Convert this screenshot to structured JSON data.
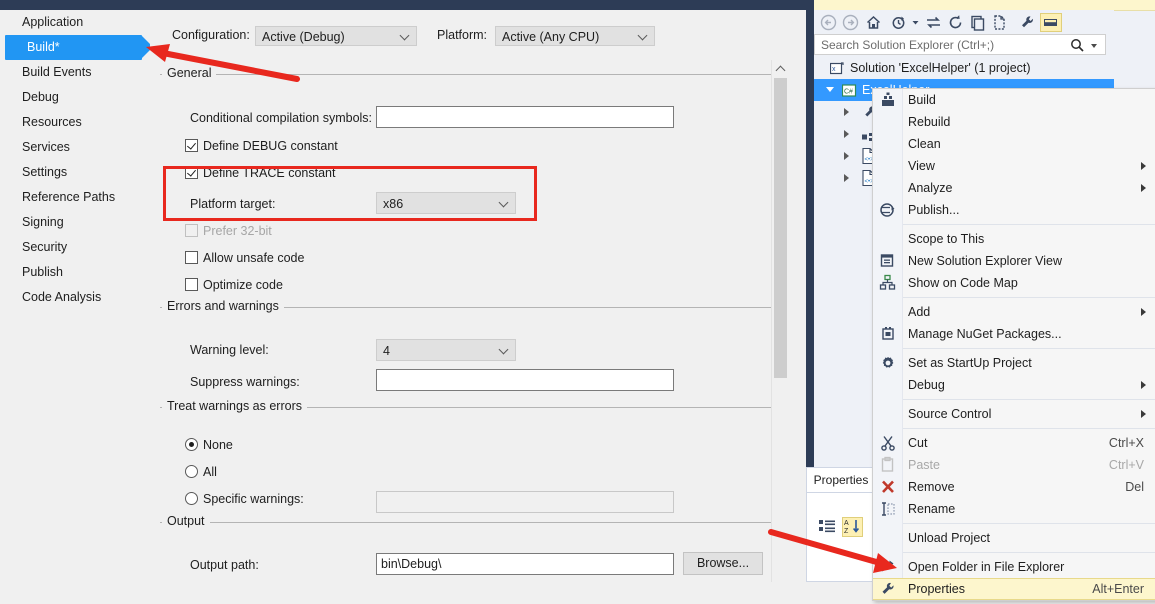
{
  "properties_page": {
    "tabs": [
      {
        "label": "Application",
        "selected": false
      },
      {
        "label": "Build*",
        "selected": true
      },
      {
        "label": "Build Events",
        "selected": false
      },
      {
        "label": "Debug",
        "selected": false
      },
      {
        "label": "Resources",
        "selected": false
      },
      {
        "label": "Services",
        "selected": false
      },
      {
        "label": "Settings",
        "selected": false
      },
      {
        "label": "Reference Paths",
        "selected": false
      },
      {
        "label": "Signing",
        "selected": false
      },
      {
        "label": "Security",
        "selected": false
      },
      {
        "label": "Publish",
        "selected": false
      },
      {
        "label": "Code Analysis",
        "selected": false
      }
    ],
    "configuration": {
      "label": "Configuration:",
      "value": "Active (Debug)"
    },
    "platform": {
      "label": "Platform:",
      "value": "Active (Any CPU)"
    },
    "general": {
      "title": "General",
      "conditional_symbols_label": "Conditional compilation symbols:",
      "conditional_symbols_value": "",
      "define_debug_label": "Define DEBUG constant",
      "define_debug_checked": true,
      "define_trace_label": "Define TRACE constant",
      "define_trace_checked": true,
      "platform_target_label": "Platform target:",
      "platform_target_value": "x86",
      "prefer32_label": "Prefer 32-bit",
      "prefer32_checked": false,
      "allow_unsafe_label": "Allow unsafe code",
      "allow_unsafe_checked": false,
      "optimize_label": "Optimize code",
      "optimize_checked": false
    },
    "errors_warnings": {
      "title": "Errors and warnings",
      "warning_level_label": "Warning level:",
      "warning_level_value": "4",
      "suppress_label": "Suppress warnings:",
      "suppress_value": ""
    },
    "treat_warnings": {
      "title": "Treat warnings as errors",
      "none_label": "None",
      "all_label": "All",
      "specific_label": "Specific warnings:",
      "specific_value": "",
      "selected": "None"
    },
    "output": {
      "title": "Output",
      "output_path_label": "Output path:",
      "output_path_value": "bin\\Debug\\",
      "browse_label": "Browse..."
    }
  },
  "solution_explorer": {
    "toolbar_icons": [
      "back-icon",
      "forward-icon",
      "home-icon",
      "pending-changes-icon",
      "sync-with-active-document-icon",
      "refresh-icon",
      "collapse-all-icon",
      "show-all-files-icon",
      "properties-icon",
      "preview-selected-items-icon"
    ],
    "search": {
      "placeholder": "Search Solution Explorer (Ctrl+;)",
      "value": ""
    },
    "tree": [
      {
        "label": "Solution 'ExcelHelper' (1 project)",
        "icon": "solution-icon",
        "depth": 0,
        "selected": false,
        "expander": "none"
      },
      {
        "label": "ExcelHelper",
        "icon": "csharp-project-icon",
        "depth": 1,
        "selected": true,
        "expander": "open"
      },
      {
        "label": "",
        "icon": "properties-wrench-icon",
        "depth": 2,
        "selected": false,
        "expander": "closed"
      },
      {
        "label": "",
        "icon": "references-icon",
        "depth": 2,
        "selected": false,
        "expander": "closed"
      },
      {
        "label": "",
        "icon": "code-file-icon",
        "depth": 2,
        "selected": false,
        "expander": "closed"
      },
      {
        "label": "",
        "icon": "code-file-icon",
        "depth": 2,
        "selected": false,
        "expander": "closed"
      }
    ],
    "properties_dock": {
      "tab_label": "Properties",
      "categorized_icon": "categorized-icon",
      "alphabetical_icon": "alphabetical-sort-icon"
    }
  },
  "context_menu": {
    "items": [
      {
        "label": "Build",
        "icon": "build-icon",
        "shortcut": "",
        "submenu": false,
        "disabled": false,
        "highlighted": false,
        "sep_after": false
      },
      {
        "label": "Rebuild",
        "icon": "",
        "shortcut": "",
        "submenu": false,
        "disabled": false,
        "highlighted": false,
        "sep_after": false
      },
      {
        "label": "Clean",
        "icon": "",
        "shortcut": "",
        "submenu": false,
        "disabled": false,
        "highlighted": false,
        "sep_after": false
      },
      {
        "label": "View",
        "icon": "",
        "shortcut": "",
        "submenu": true,
        "disabled": false,
        "highlighted": false,
        "sep_after": false
      },
      {
        "label": "Analyze",
        "icon": "",
        "shortcut": "",
        "submenu": true,
        "disabled": false,
        "highlighted": false,
        "sep_after": false
      },
      {
        "label": "Publish...",
        "icon": "publish-icon",
        "shortcut": "",
        "submenu": false,
        "disabled": false,
        "highlighted": false,
        "sep_after": true
      },
      {
        "label": "Scope to This",
        "icon": "",
        "shortcut": "",
        "submenu": false,
        "disabled": false,
        "highlighted": false,
        "sep_after": false
      },
      {
        "label": "New Solution Explorer View",
        "icon": "new-window-icon",
        "shortcut": "",
        "submenu": false,
        "disabled": false,
        "highlighted": false,
        "sep_after": false
      },
      {
        "label": "Show on Code Map",
        "icon": "code-map-icon",
        "shortcut": "",
        "submenu": false,
        "disabled": false,
        "highlighted": false,
        "sep_after": true
      },
      {
        "label": "Add",
        "icon": "",
        "shortcut": "",
        "submenu": true,
        "disabled": false,
        "highlighted": false,
        "sep_after": false
      },
      {
        "label": "Manage NuGet Packages...",
        "icon": "nuget-icon",
        "shortcut": "",
        "submenu": false,
        "disabled": false,
        "highlighted": false,
        "sep_after": true
      },
      {
        "label": "Set as StartUp Project",
        "icon": "gear-icon",
        "shortcut": "",
        "submenu": false,
        "disabled": false,
        "highlighted": false,
        "sep_after": false
      },
      {
        "label": "Debug",
        "icon": "",
        "shortcut": "",
        "submenu": true,
        "disabled": false,
        "highlighted": false,
        "sep_after": true
      },
      {
        "label": "Source Control",
        "icon": "",
        "shortcut": "",
        "submenu": true,
        "disabled": false,
        "highlighted": false,
        "sep_after": true
      },
      {
        "label": "Cut",
        "icon": "cut-icon",
        "shortcut": "Ctrl+X",
        "submenu": false,
        "disabled": false,
        "highlighted": false,
        "sep_after": false
      },
      {
        "label": "Paste",
        "icon": "paste-icon",
        "shortcut": "Ctrl+V",
        "submenu": false,
        "disabled": true,
        "highlighted": false,
        "sep_after": false
      },
      {
        "label": "Remove",
        "icon": "remove-x-icon",
        "shortcut": "Del",
        "submenu": false,
        "disabled": false,
        "highlighted": false,
        "sep_after": false
      },
      {
        "label": "Rename",
        "icon": "rename-icon",
        "shortcut": "",
        "submenu": false,
        "disabled": false,
        "highlighted": false,
        "sep_after": true
      },
      {
        "label": "Unload Project",
        "icon": "",
        "shortcut": "",
        "submenu": false,
        "disabled": false,
        "highlighted": false,
        "sep_after": true
      },
      {
        "label": "Open Folder in File Explorer",
        "icon": "open-folder-icon",
        "shortcut": "",
        "submenu": false,
        "disabled": false,
        "highlighted": false,
        "sep_after": false
      },
      {
        "label": "Properties",
        "icon": "properties-wrench-icon",
        "shortcut": "Alt+Enter",
        "submenu": false,
        "disabled": false,
        "highlighted": true,
        "sep_after": false
      }
    ]
  },
  "annotations": {
    "highlight_color": "#e8281e",
    "box_target": "platform-target-row",
    "arrow_1_target": "build-tab",
    "arrow_2_target": "properties-menu-item"
  }
}
